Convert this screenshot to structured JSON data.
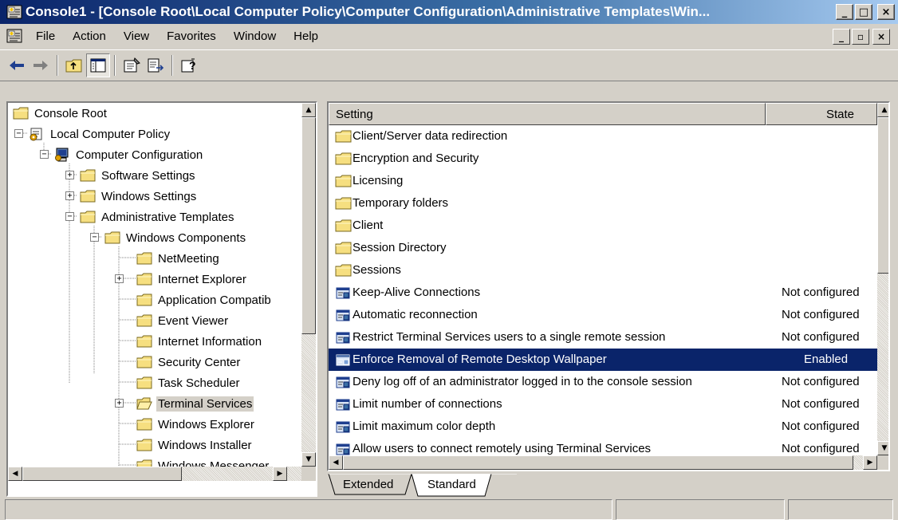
{
  "window": {
    "title": "Console1 - [Console Root\\Local Computer Policy\\Computer Configuration\\Administrative Templates\\Win...",
    "controls": {
      "minimize": "_",
      "maximize": "□",
      "close": "×"
    }
  },
  "menubar": {
    "items": [
      "File",
      "Action",
      "View",
      "Favorites",
      "Window",
      "Help"
    ],
    "mdi_controls": {
      "minimize": "_",
      "restore": "▫",
      "close": "×"
    }
  },
  "toolbar": {
    "buttons": [
      "back-icon",
      "forward-icon",
      "up-one-level-icon",
      "show-hide-tree-icon",
      "properties-icon",
      "export-list-icon",
      "help-icon"
    ]
  },
  "tree": {
    "items": [
      {
        "label": "Console Root",
        "icon": "folder-icon",
        "expander": ""
      },
      {
        "label": "Local Computer Policy",
        "icon": "policy-icon",
        "expander": "−"
      },
      {
        "label": "Computer Configuration",
        "icon": "computer-icon",
        "expander": "−"
      },
      {
        "label": "Software Settings",
        "icon": "folder-icon",
        "expander": "+"
      },
      {
        "label": "Windows Settings",
        "icon": "folder-icon",
        "expander": "+"
      },
      {
        "label": "Administrative Templates",
        "icon": "folder-icon",
        "expander": "−"
      },
      {
        "label": "Windows Components",
        "icon": "folder-icon",
        "expander": "−"
      },
      {
        "label": "NetMeeting",
        "icon": "folder-icon",
        "expander": ""
      },
      {
        "label": "Internet Explorer",
        "icon": "folder-icon",
        "expander": "+"
      },
      {
        "label": "Application Compatib",
        "icon": "folder-icon",
        "expander": ""
      },
      {
        "label": "Event Viewer",
        "icon": "folder-icon",
        "expander": ""
      },
      {
        "label": "Internet Information",
        "icon": "folder-icon",
        "expander": ""
      },
      {
        "label": "Security Center",
        "icon": "folder-icon",
        "expander": ""
      },
      {
        "label": "Task Scheduler",
        "icon": "folder-icon",
        "expander": ""
      },
      {
        "label": "Terminal Services",
        "icon": "open-folder-icon",
        "expander": "+",
        "selected": true
      },
      {
        "label": "Windows Explorer",
        "icon": "folder-icon",
        "expander": ""
      },
      {
        "label": "Windows Installer",
        "icon": "folder-icon",
        "expander": ""
      },
      {
        "label": "Windows Messenger",
        "icon": "folder-icon",
        "expander": ""
      }
    ]
  },
  "list": {
    "columns": {
      "setting": "Setting",
      "state": "State"
    },
    "rows": [
      {
        "name": "Client/Server data redirection",
        "state": "",
        "icon": "folder-icon"
      },
      {
        "name": "Encryption and Security",
        "state": "",
        "icon": "folder-icon"
      },
      {
        "name": "Licensing",
        "state": "",
        "icon": "folder-icon"
      },
      {
        "name": "Temporary folders",
        "state": "",
        "icon": "folder-icon"
      },
      {
        "name": "Client",
        "state": "",
        "icon": "folder-icon"
      },
      {
        "name": "Session Directory",
        "state": "",
        "icon": "folder-icon"
      },
      {
        "name": "Sessions",
        "state": "",
        "icon": "folder-icon"
      },
      {
        "name": "Keep-Alive Connections",
        "state": "Not configured",
        "icon": "policy-setting-icon"
      },
      {
        "name": "Automatic reconnection",
        "state": "Not configured",
        "icon": "policy-setting-icon"
      },
      {
        "name": "Restrict Terminal Services users to a single remote session",
        "state": "Not configured",
        "icon": "policy-setting-icon"
      },
      {
        "name": "Enforce Removal of Remote Desktop Wallpaper",
        "state": "Enabled",
        "icon": "policy-setting-enabled-icon",
        "selected": true
      },
      {
        "name": "Deny log off of an administrator logged in to the console session",
        "state": "Not configured",
        "icon": "policy-setting-icon"
      },
      {
        "name": "Limit number of connections",
        "state": "Not configured",
        "icon": "policy-setting-icon"
      },
      {
        "name": "Limit maximum color depth",
        "state": "Not configured",
        "icon": "policy-setting-icon"
      },
      {
        "name": "Allow users to connect remotely using Terminal Services",
        "state": "Not configured",
        "icon": "policy-setting-icon"
      }
    ]
  },
  "tabs": {
    "items": [
      "Extended",
      "Standard"
    ],
    "active": "Standard"
  },
  "colors": {
    "selection": "#0a246a",
    "folder": "#f6df80",
    "face": "#d4d0c8"
  }
}
